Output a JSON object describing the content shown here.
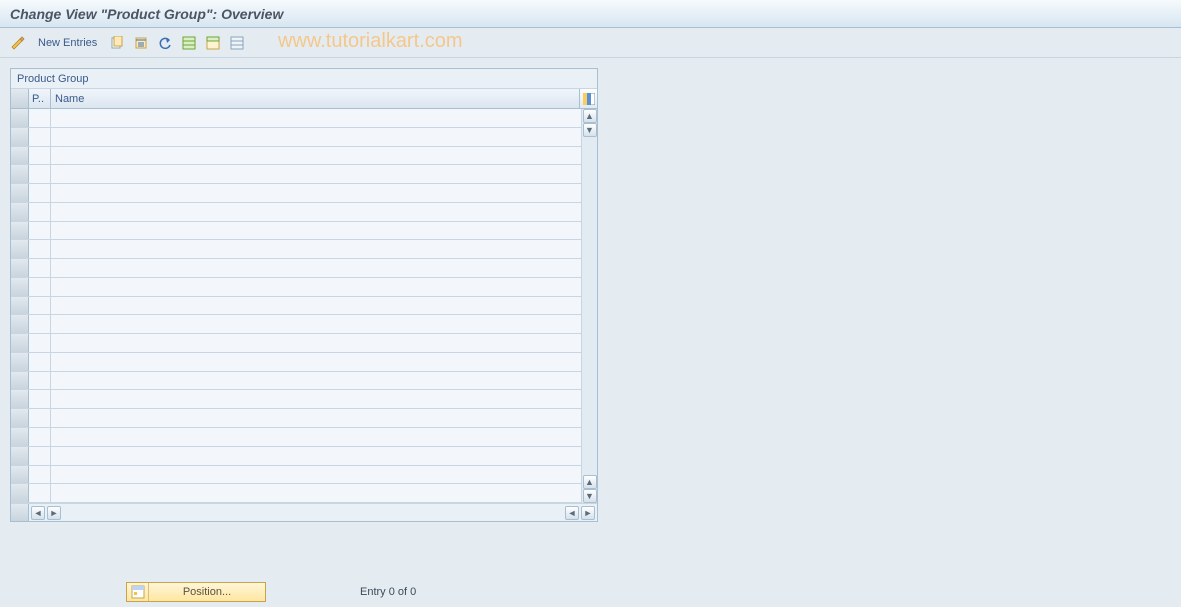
{
  "header": {
    "title": "Change View \"Product Group\": Overview"
  },
  "toolbar": {
    "new_entries_label": "New Entries"
  },
  "watermark": "www.tutorialkart.com",
  "panel": {
    "title": "Product Group",
    "col_p": "P..",
    "col_name": "Name",
    "row_count": 21
  },
  "footer": {
    "position_label": "Position...",
    "entry_label": "Entry 0 of 0"
  }
}
